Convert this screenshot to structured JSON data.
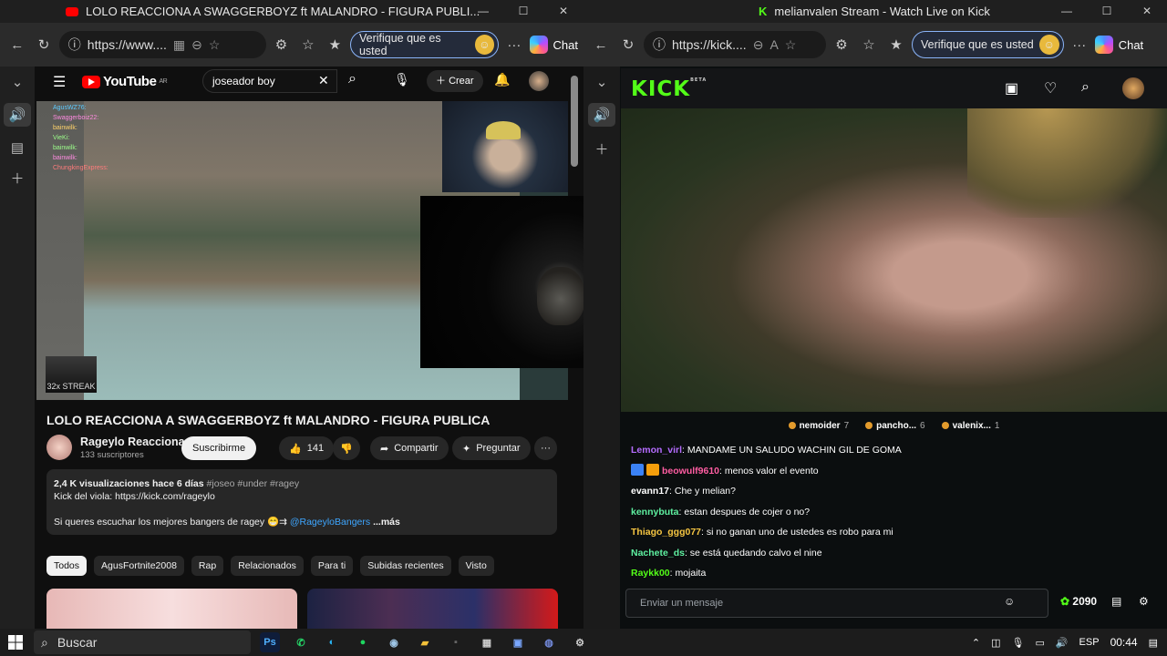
{
  "left_window": {
    "title": "LOLO REACCIONA A SWAGGERBOYZ ft MALANDRO - FIGURA PUBLI...",
    "url": "https://www....",
    "verify_label": "Verifique que es usted",
    "chat_label": "Chat"
  },
  "youtube": {
    "logo_text": "YouTube",
    "country": "AR",
    "search_value": "joseador boy",
    "create_label": "Crear",
    "stream_chat": [
      "AgusWZ76:",
      "Swaggerboiz22:",
      "bainwilk:",
      "VieKi:",
      "bainwilk:",
      "bainwilk:",
      "ChungkingExpress:"
    ],
    "streak_label": "32x STREAK",
    "video_title": "LOLO REACCIONA A SWAGGERBOYZ ft MALANDRO - FIGURA PUBLICA",
    "channel_name": "Rageylo Reacciona",
    "subscribers": "133 suscriptores",
    "subscribe_label": "Suscribirme",
    "likes": "141",
    "share_label": "Compartir",
    "ask_label": "Preguntar",
    "desc_views": "2,4 K visualizaciones",
    "desc_age": "hace 6 días",
    "desc_tags": "#joseo #under #ragey",
    "desc_line2": "Kick del viola: https://kick.com/rageylo",
    "desc_line3": "Si queres escuchar los mejores bangers de ragey 😁⇉",
    "desc_link": "@RageyloBangers",
    "desc_more": "...más",
    "chips": [
      "Todos",
      "AgusFortnite2008",
      "Rap",
      "Relacionados",
      "Para ti",
      "Subidas recientes",
      "Visto"
    ]
  },
  "right_window": {
    "title": "melianvalen Stream - Watch Live on Kick",
    "url": "https://kick....",
    "verify_label": "Verifique que es usted",
    "chat_label": "Chat"
  },
  "kick": {
    "logo_text": "KICK",
    "logo_sup": "BETA",
    "leaderboard": [
      {
        "name": "nemoider",
        "count": "7"
      },
      {
        "name": "pancho...",
        "count": "6"
      },
      {
        "name": "valenix...",
        "count": "1"
      }
    ],
    "chat": [
      {
        "user": "Lemon_virl",
        "color": "#b56cff",
        "text": "MANDAME UN SALUDO WACHIN GIL DE GOMA",
        "badges": []
      },
      {
        "user": "beowulf9610",
        "color": "#ff5da2",
        "text": "menos valor el evento",
        "badges": [
          "#3b82f6",
          "#f59e0b"
        ]
      },
      {
        "user": "evann17",
        "color": "#ffffff",
        "text": "Che y melian?",
        "badges": []
      },
      {
        "user": "kennybuta",
        "color": "#5ef0a0",
        "text": "estan despues de cojer o no?",
        "badges": []
      },
      {
        "user": "Thiago_ggg077",
        "color": "#f5c542",
        "text": "si no ganan uno de ustedes es robo para mi",
        "badges": []
      },
      {
        "user": "Nachete_ds",
        "color": "#5ef0a0",
        "text": "se está quedando calvo el nine",
        "badges": []
      },
      {
        "user": "Raykk00",
        "color": "#53fc18",
        "text": "mojaita",
        "badges": []
      }
    ],
    "input_placeholder": "Enviar un mensaje",
    "points": "2090"
  },
  "taskbar": {
    "search_label": "Buscar",
    "lang": "ESP",
    "time": "00:44"
  }
}
